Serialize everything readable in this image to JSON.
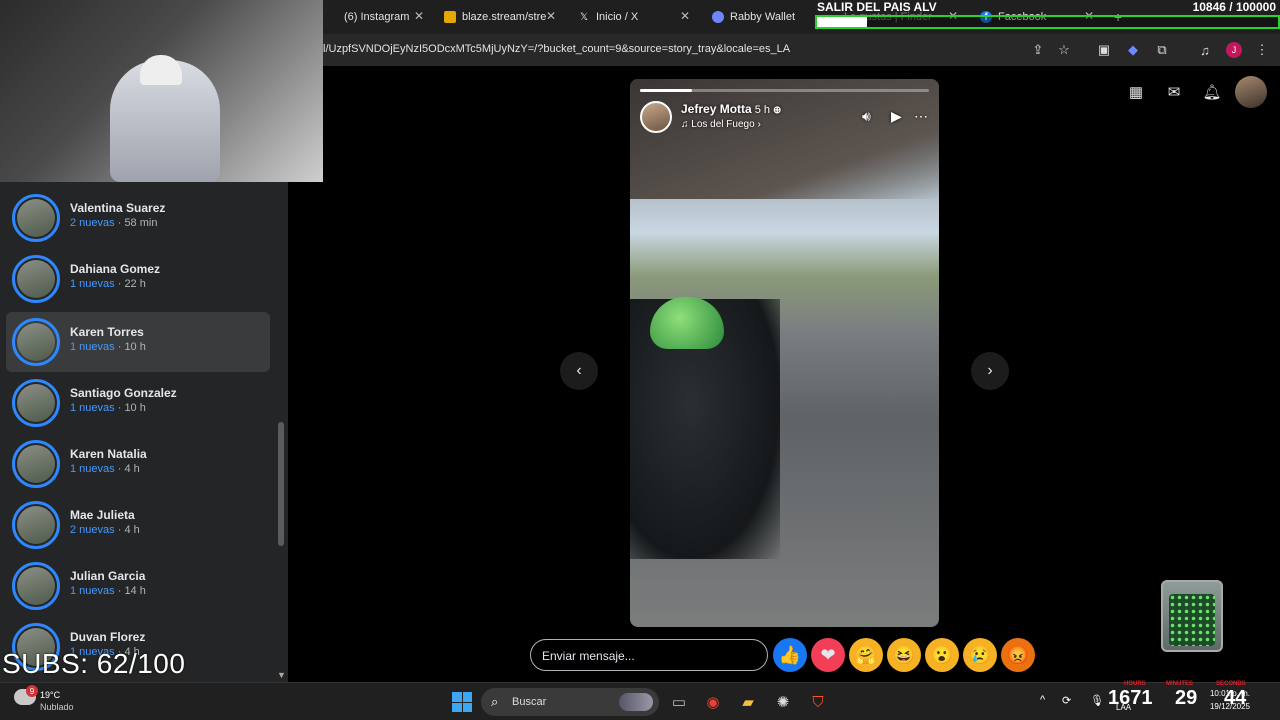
{
  "browser": {
    "tabs": [
      {
        "title": "(6) Instagram",
        "icon": "instagram-icon"
      },
      {
        "title": "blaze.stream/stre",
        "icon": "blaze-icon"
      },
      {
        "title": "Inicio / X",
        "icon": "x-icon"
      },
      {
        "title": "Rabby Wallet",
        "icon": "rabby-icon"
      },
      {
        "title": "Le gustas | Finder",
        "icon": "finder-icon"
      },
      {
        "title": "Facebook",
        "icon": "facebook-icon"
      }
    ],
    "url": "l/UzpfSVNDOjEyNzI5ODcxMTc5MjUyNzY=/?bucket_count=9&source=story_tray&locale=es_LA",
    "profile_initial": "J"
  },
  "overlay": {
    "goal_title": "SALIR DEL PAIS ALV",
    "goal_count": "10846 / 100000",
    "goal_progress": 0.108,
    "subs": "SUBS: 62/100"
  },
  "sidebar": {
    "stories": [
      {
        "name": "Valentina Suarez",
        "new": "2 nuevas",
        "time": "58 min"
      },
      {
        "name": "Dahiana Gomez",
        "new": "1 nuevas",
        "time": "22 h"
      },
      {
        "name": "Karen Torres",
        "new": "1 nuevas",
        "time": "10 h"
      },
      {
        "name": "Santiago Gonzalez",
        "new": "1 nuevas",
        "time": "10 h"
      },
      {
        "name": "Karen Natalia",
        "new": "1 nuevas",
        "time": "4 h"
      },
      {
        "name": "Mae Julieta",
        "new": "2 nuevas",
        "time": "4 h"
      },
      {
        "name": "Julian Garcia",
        "new": "1 nuevas",
        "time": "14 h"
      },
      {
        "name": "Duvan Florez",
        "new": "1 nuevas",
        "time": "4 h"
      }
    ],
    "separator": " · "
  },
  "story": {
    "author": "Jefrey Motta",
    "time": "5 h",
    "song": "Los del Fuego",
    "progress": 0.18
  },
  "reply": {
    "placeholder": "Enviar mensaje..."
  },
  "reactions": [
    {
      "name": "like",
      "color": "#1877f2",
      "glyph": "👍"
    },
    {
      "name": "love",
      "color": "#f33e58",
      "glyph": "❤"
    },
    {
      "name": "care",
      "color": "#f7b125",
      "glyph": "🤗"
    },
    {
      "name": "haha",
      "color": "#f7b125",
      "glyph": "😆"
    },
    {
      "name": "wow",
      "color": "#f7b125",
      "glyph": "😮"
    },
    {
      "name": "sad",
      "color": "#f7b125",
      "glyph": "😢"
    },
    {
      "name": "angry",
      "color": "#e9710f",
      "glyph": "😡"
    }
  ],
  "taskbar": {
    "weather_temp": "19°C",
    "weather_desc": "Nublado",
    "weather_badge": "9",
    "search_label": "Buscar",
    "lang": "LAA",
    "counter_hours": "1671",
    "counter_minutes": "29",
    "counter_seconds": "44",
    "counter_label_hours": "HOURS",
    "counter_label_minutes": "MINUTES",
    "counter_label_seconds": "SECONDS",
    "clock_time": "10:01 p. m.",
    "clock_date": "19/12/2025"
  }
}
